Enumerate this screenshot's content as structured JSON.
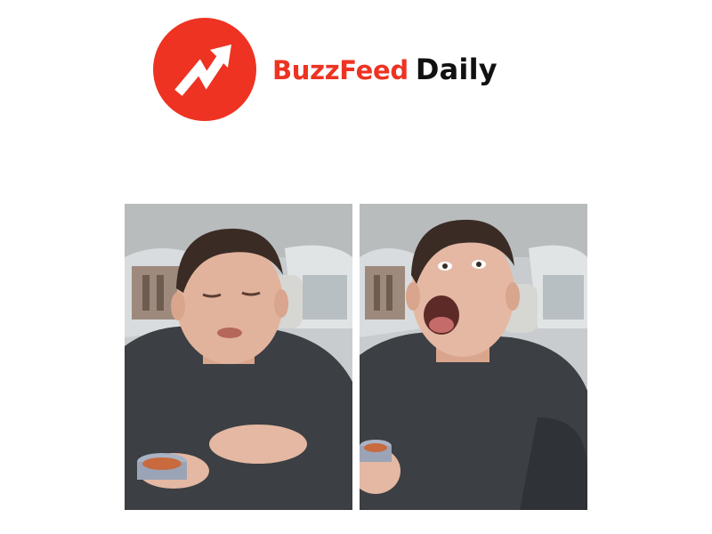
{
  "header": {
    "brand": "BuzzFeed",
    "sub_brand": "Daily",
    "logo_icon": "trending-arrow-icon"
  },
  "colors": {
    "brand_red": "#ee3322",
    "text_dark": "#111111",
    "background": "#ffffff"
  },
  "panels": [
    {
      "name": "photo-before-reaction",
      "icon": "person-tasting-sauce"
    },
    {
      "name": "photo-after-reaction",
      "icon": "person-shouting"
    }
  ]
}
